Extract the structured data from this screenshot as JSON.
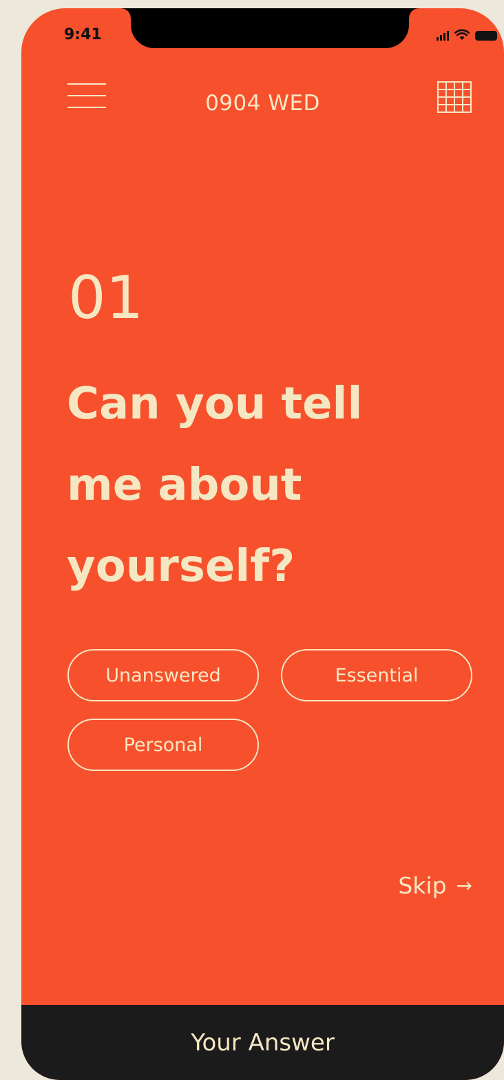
{
  "status_bar": {
    "time": "9:41",
    "icons": [
      "signal-icon",
      "wifi-icon",
      "battery-icon"
    ]
  },
  "header": {
    "menu_icon": "hamburger-menu-icon",
    "date": "0904 WED",
    "grid_icon": "calendar-grid-icon"
  },
  "question": {
    "number": "01",
    "lines": [
      "Can you tell",
      "me about",
      "yourself?"
    ]
  },
  "tags": [
    "Unanswered",
    "Essential",
    "Personal"
  ],
  "skip": {
    "label": "Skip",
    "arrow": "→"
  },
  "answer_bar": {
    "label": "Your Answer"
  },
  "colors": {
    "background": "#f7502d",
    "accent_text": "#f6e7c3",
    "bottom_bar": "#1b1b1b",
    "page_bg": "#ede8dc"
  }
}
